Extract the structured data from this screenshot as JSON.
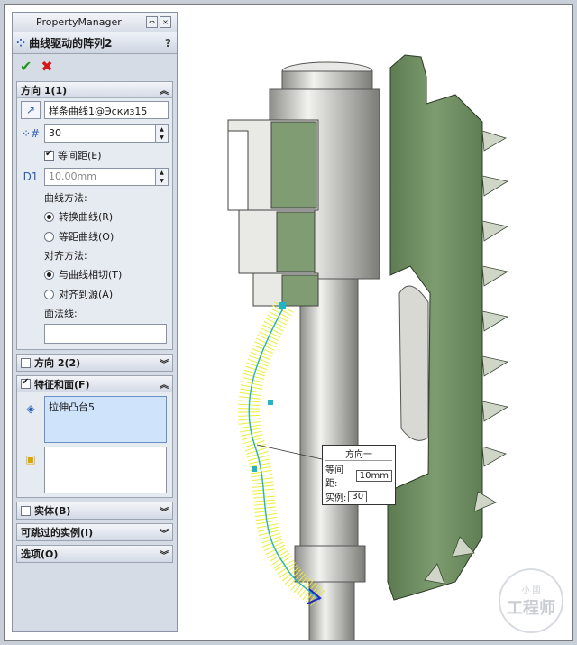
{
  "pm": {
    "title": "PropertyManager",
    "feature_title": "曲线驱动的阵列2",
    "help": "?",
    "ok": "✔",
    "cancel": "✖"
  },
  "direction1": {
    "header": "方向 1(1)",
    "curve_ref": "样条曲线1@Эскиз15",
    "instances": "30",
    "equal_spacing_label": "等间距(E)",
    "spacing": "10.00mm",
    "curve_method_label": "曲线方法:",
    "curve_methods": [
      "转换曲线(R)",
      "等距曲线(O)"
    ],
    "align_label": "对齐方法:",
    "align_methods": [
      "与曲线相切(T)",
      "对齐到源(A)"
    ],
    "face_label": "面法线:"
  },
  "direction2": {
    "header": "方向 2(2)"
  },
  "features": {
    "header": "特征和面(F)",
    "items": [
      "拉伸凸台5"
    ]
  },
  "bodies": {
    "header": "实体(B)"
  },
  "skip": {
    "header": "可跳过的实例(I)"
  },
  "options": {
    "header": "选项(O)"
  },
  "callout": {
    "title": "方向一",
    "spacing_label": "等间距:",
    "spacing_value": "10mm",
    "instances_label": "实例:",
    "instances_value": "30"
  },
  "watermark": {
    "top": "小 國",
    "bottom": "工程师"
  },
  "colors": {
    "part_green": "#6f8f62",
    "part_grey": "#c8c8c4",
    "pattern_yellow": "#ecec2a"
  }
}
